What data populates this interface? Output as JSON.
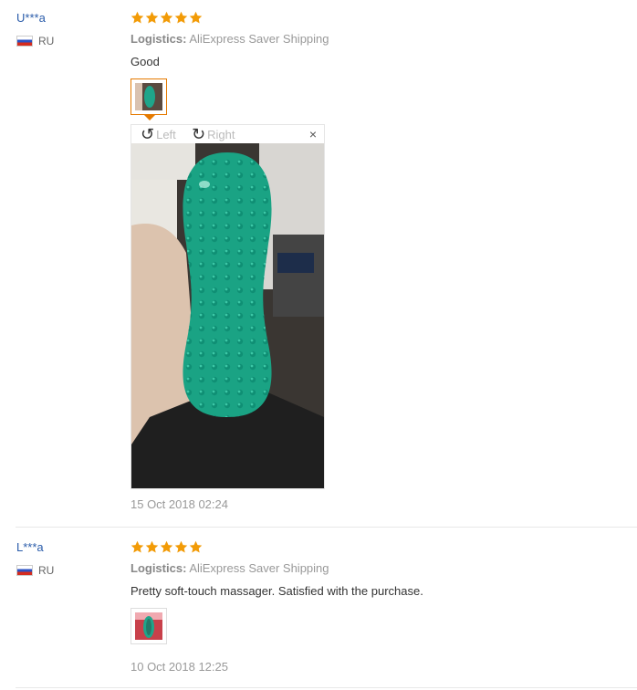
{
  "reviews": [
    {
      "user": "U***a",
      "country": "RU",
      "rating": 5,
      "logistics_label": "Logistics:",
      "logistics_value": "AliExpress Saver Shipping",
      "text": "Good",
      "date": "15 Oct 2018 02:24",
      "viewer": {
        "left": "Left",
        "right": "Right",
        "close": "×"
      }
    },
    {
      "user": "L***a",
      "country": "RU",
      "rating": 5,
      "logistics_label": "Logistics:",
      "logistics_value": "AliExpress Saver Shipping",
      "text": "Pretty soft-touch massager. Satisfied with the purchase.",
      "date": "10 Oct 2018 12:25"
    }
  ],
  "colors": {
    "star": "#f29b07",
    "user_link": "#2a5caa",
    "active_thumb": "#e57a00"
  },
  "icons": {
    "rotate_left": "rotate-left-icon",
    "rotate_right": "rotate-right-icon",
    "close": "close-icon",
    "star": "star-icon",
    "flag": "russia-flag-icon"
  }
}
